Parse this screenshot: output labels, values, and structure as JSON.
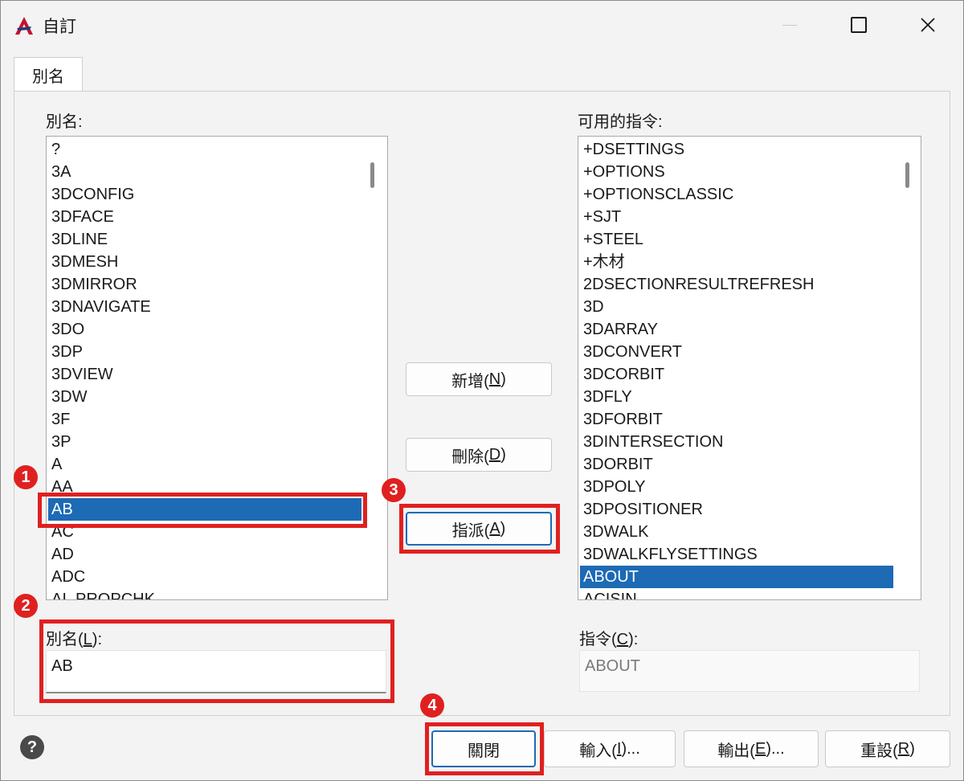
{
  "window": {
    "title": "自訂",
    "brand_color": "#c8102e"
  },
  "tabs": [
    {
      "label": "別名"
    }
  ],
  "alias_list": {
    "label": "別名:",
    "items": [
      "?",
      "3A",
      "3DCONFIG",
      "3DFACE",
      "3DLINE",
      "3DMESH",
      "3DMIRROR",
      "3DNAVIGATE",
      "3DO",
      "3DP",
      "3DVIEW",
      "3DW",
      "3F",
      "3P",
      "A",
      "AA",
      "AB",
      "AC",
      "AD",
      "ADC",
      "AI_PROPCHK"
    ],
    "selected": "AB"
  },
  "command_list": {
    "label": "可用的指令:",
    "items": [
      "+DSETTINGS",
      "+OPTIONS",
      "+OPTIONSCLASSIC",
      "+SJT",
      "+STEEL",
      "+木材",
      "2DSECTIONRESULTREFRESH",
      "3D",
      "3DARRAY",
      "3DCONVERT",
      "3DCORBIT",
      "3DFLY",
      "3DFORBIT",
      "3DINTERSECTION",
      "3DORBIT",
      "3DPOLY",
      "3DPOSITIONER",
      "3DWALK",
      "3DWALKFLYSETTINGS",
      "ABOUT",
      "ACISIN"
    ],
    "selected": "ABOUT"
  },
  "middle_buttons": {
    "add": {
      "text": "新增(",
      "key": "N",
      "end": ")"
    },
    "delete": {
      "text": "刪除(",
      "key": "D",
      "end": ")"
    },
    "assign": {
      "text": "指派(",
      "key": "A",
      "end": ")"
    }
  },
  "alias_field": {
    "label_text": "別名(",
    "label_key": "L",
    "label_end": "):",
    "value": "AB"
  },
  "command_field": {
    "label_text": "指令(",
    "label_key": "C",
    "label_end": "):",
    "value": "ABOUT"
  },
  "bottom_buttons": {
    "close": {
      "text": "關閉"
    },
    "import": {
      "text": "輸入(",
      "key": "I",
      "end": ")..."
    },
    "export": {
      "text": "輸出(",
      "key": "E",
      "end": ")..."
    },
    "reset": {
      "text": "重設(",
      "key": "R",
      "end": ")"
    }
  },
  "help_icon": "?",
  "annotations": {
    "color": "#e02020",
    "badges": [
      "1",
      "2",
      "3",
      "4"
    ]
  }
}
